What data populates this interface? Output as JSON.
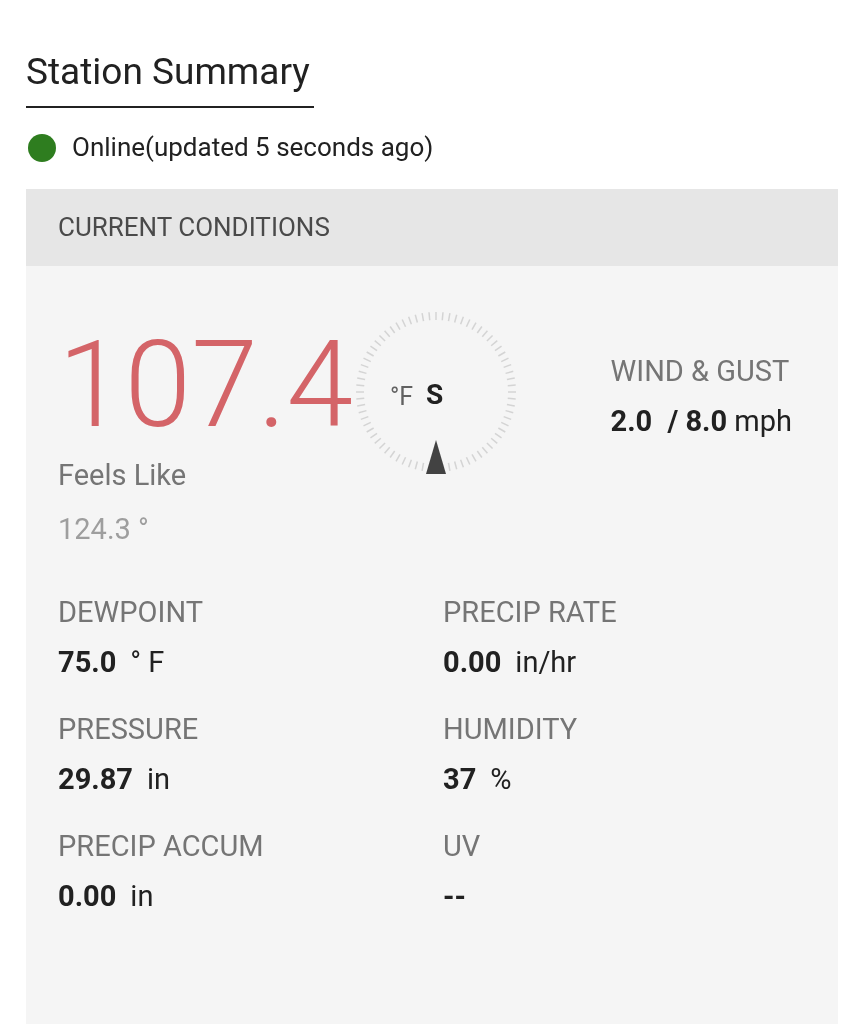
{
  "title": "Station Summary",
  "status": {
    "online": true,
    "text": "Online(updated 5 seconds ago)"
  },
  "panel": {
    "header": "CURRENT CONDITIONS",
    "temperature": {
      "value": "107.4",
      "unit": "°F",
      "feels_label": "Feels Like",
      "feels_value": "124.3 °"
    },
    "compass": {
      "direction": "S"
    },
    "wind": {
      "label": "WIND & GUST",
      "speed": "2.0",
      "gust": "/ 8.0",
      "unit": "mph"
    },
    "metrics": [
      {
        "label": "DEWPOINT",
        "value": "75.0",
        "unit": "° F"
      },
      {
        "label": "PRECIP RATE",
        "value": "0.00",
        "unit": "in/hr"
      },
      {
        "label": "PRESSURE",
        "value": "29.87",
        "unit": "in"
      },
      {
        "label": "HUMIDITY",
        "value": "37",
        "unit": "%"
      },
      {
        "label": "PRECIP ACCUM",
        "value": "0.00",
        "unit": "in"
      },
      {
        "label": "UV",
        "value": "--"
      }
    ]
  }
}
